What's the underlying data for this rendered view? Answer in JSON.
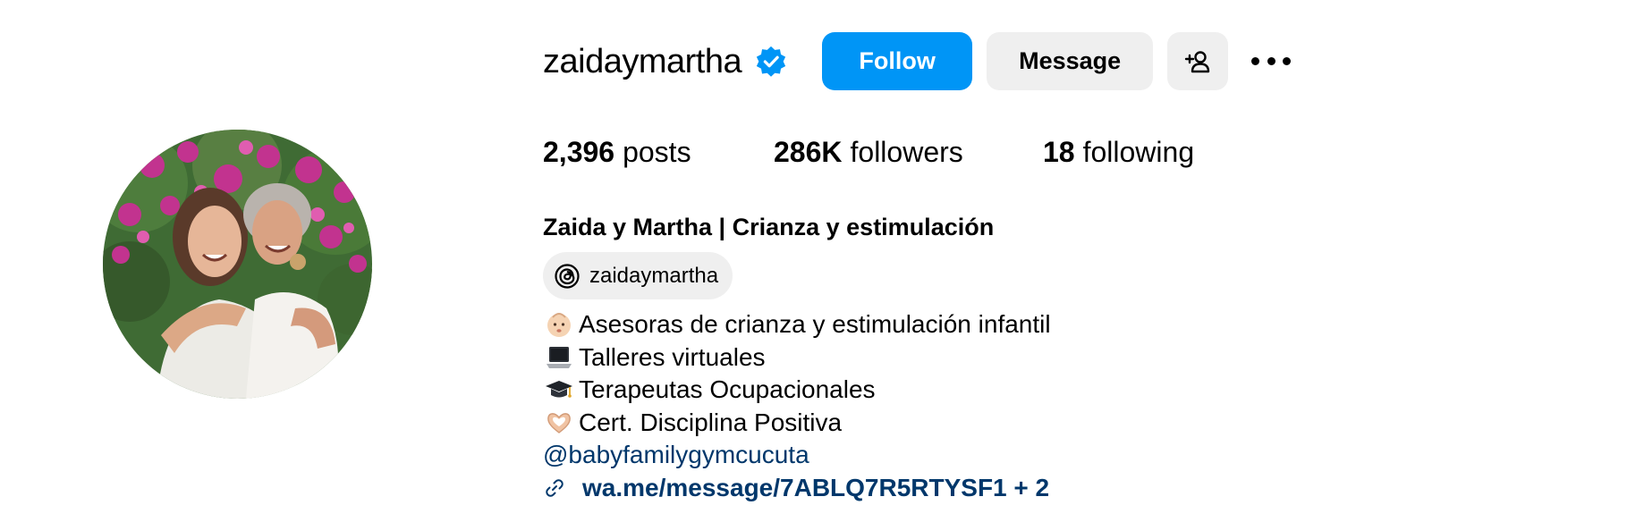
{
  "profile": {
    "username": "zaidaymartha",
    "verified": true,
    "full_name": "Zaida y Martha | Crianza y estimulación"
  },
  "actions": {
    "follow_label": "Follow",
    "message_label": "Message"
  },
  "stats": {
    "posts_count": "2,396",
    "posts_label": "posts",
    "followers_count": "286K",
    "followers_label": "followers",
    "following_count": "18",
    "following_label": "following"
  },
  "threads": {
    "handle": "zaidaymartha"
  },
  "bio": {
    "lines": [
      {
        "icon": "baby-emoji",
        "text": "Asesoras de crianza y estimulación infantil"
      },
      {
        "icon": "laptop-emoji",
        "text": "Talleres virtuales"
      },
      {
        "icon": "graduation-cap-emoji",
        "text": "Terapeutas Ocupacionales"
      },
      {
        "icon": "heart-hands-emoji",
        "text": "Cert. Disciplina Positiva"
      }
    ],
    "mention": "@babyfamilygymcucuta",
    "link_text": "wa.me/message/7ABLQ7R5RTYSF1 + 2"
  },
  "colors": {
    "primary_button": "#0095f6",
    "secondary_button": "#efefef",
    "link": "#00376b",
    "verified_badge": "#0095f6"
  }
}
